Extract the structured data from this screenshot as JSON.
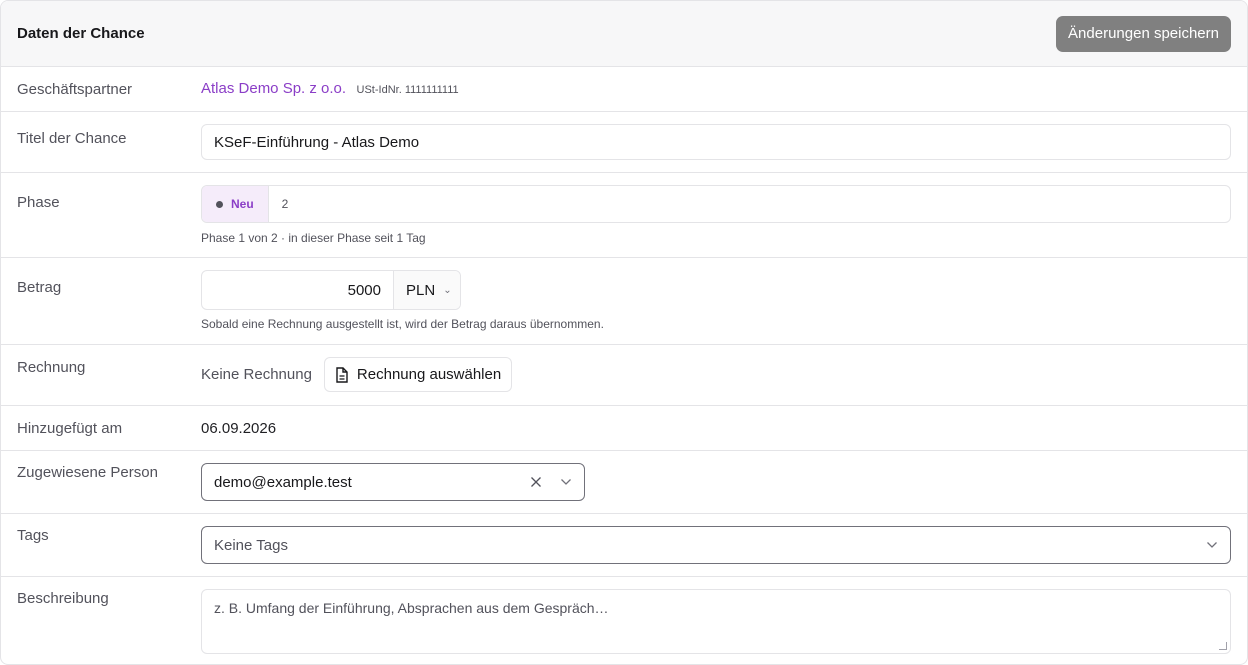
{
  "header": {
    "title": "Daten der Chance",
    "save_label": "Änderungen speichern"
  },
  "fields": {
    "partner": {
      "label": "Geschäftspartner",
      "name": "Atlas Demo Sp. z o.o.",
      "vat": "USt-IdNr. 1111111111"
    },
    "title": {
      "label": "Titel der Chance",
      "value": "KSeF-Einführung - Atlas Demo"
    },
    "phase": {
      "label": "Phase",
      "current": "Neu",
      "next": "2",
      "help": "Phase 1 von 2 · in dieser Phase seit 1 Tag"
    },
    "amount": {
      "label": "Betrag",
      "value": "5000",
      "currency": "PLN",
      "help": "Sobald eine Rechnung ausgestellt ist, wird der Betrag daraus übernommen."
    },
    "invoice": {
      "label": "Rechnung",
      "status": "Keine Rechnung",
      "select_label": "Rechnung auswählen"
    },
    "added": {
      "label": "Hinzugefügt am",
      "value": "06.09.2026"
    },
    "assignee": {
      "label": "Zugewiesene Person",
      "value": "demo@example.test"
    },
    "tags": {
      "label": "Tags",
      "value": "Keine Tags"
    },
    "description": {
      "label": "Beschreibung",
      "placeholder": "z. B. Umfang der Einführung, Absprachen aus dem Gespräch…"
    }
  },
  "icons": {
    "clear": "close-icon",
    "dropdown": "chevron-down-icon",
    "document": "document-icon"
  },
  "colors": {
    "accent": "#8b3ec7",
    "save_button": "#808080",
    "phase_badge_bg": "#f5ecfa"
  }
}
